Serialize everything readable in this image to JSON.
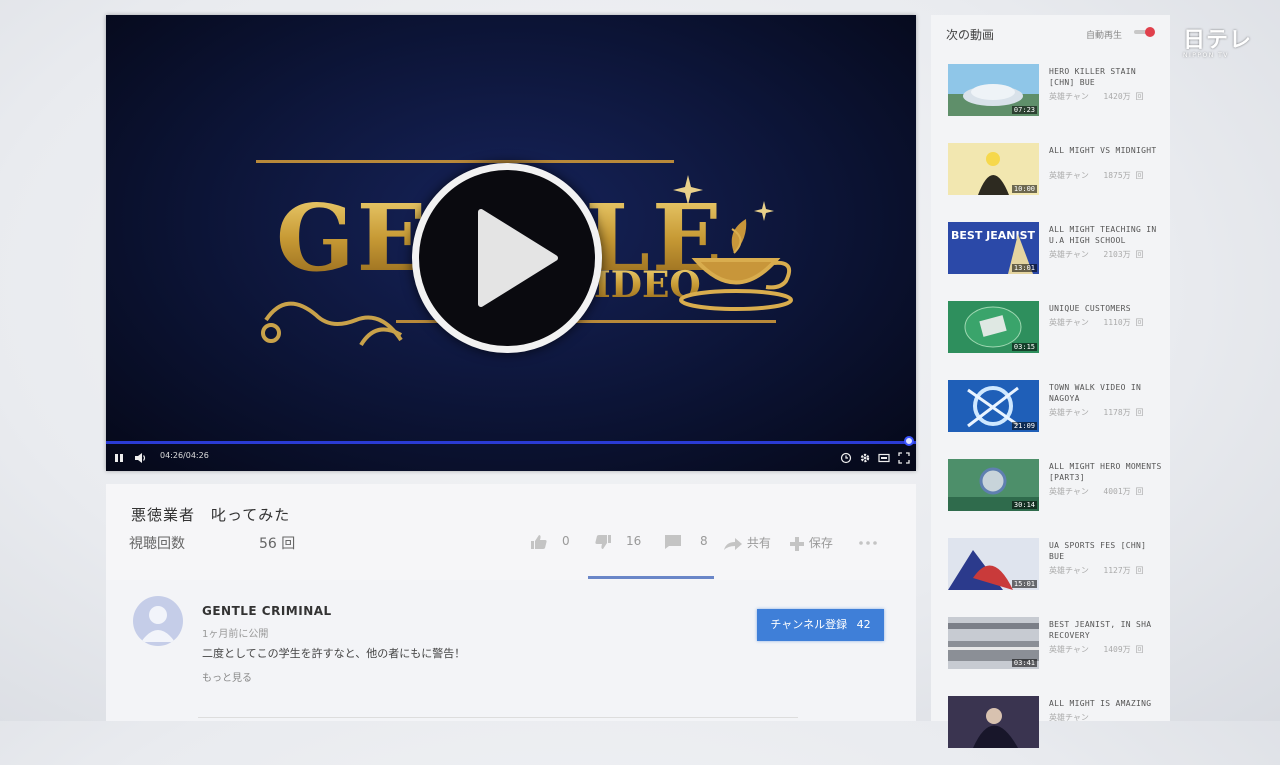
{
  "player": {
    "time": "04:26/04:26",
    "progress": 1.0,
    "logo_word1": "GENTLE",
    "logo_word2": "VIDEO",
    "accent_color": "#2a3bd4"
  },
  "video": {
    "title": "悪徳業者　叱ってみた",
    "views_label": "視聴回数",
    "views_count": "56 回",
    "likes": "0",
    "dislikes": "16",
    "comments": "8",
    "share_label": "共有",
    "save_label": "保存"
  },
  "channel": {
    "name": "GENTLE CRIMINAL",
    "published": "1ヶ月前に公開",
    "description": "二度としてこの学生を許すなと、他の者にもに警告！",
    "more_label": "もっと見る",
    "subscribe_label": "チャンネル登録",
    "subscribers": "42",
    "subscribe_color": "#3f7fd8"
  },
  "sidebar": {
    "title": "次の動画",
    "autoplay_label": "自動再生",
    "items": [
      {
        "title": "HERO KILLER STAIN [CHN] BUE",
        "channel": "英雄チャン",
        "views": "1420万 回",
        "duration": "07:23",
        "thumb": "stadium"
      },
      {
        "title": "ALL MIGHT VS MIDNIGHT",
        "channel": "英雄チャン",
        "views": "1875万 回",
        "duration": "10:00",
        "thumb": "hero"
      },
      {
        "title": "ALL MIGHT TEACHING IN U.A HIGH SCHOOL",
        "channel": "英雄チャン",
        "views": "2103万 回",
        "duration": "13:01",
        "thumb": "jeanist"
      },
      {
        "title": "UNIQUE CUSTOMERS",
        "channel": "英雄チャン",
        "views": "1110万 回",
        "duration": "03:15",
        "thumb": "field"
      },
      {
        "title": "TOWN WALK VIDEO IN NAGOYA",
        "channel": "英雄チャン",
        "views": "1178万 回",
        "duration": "21:09",
        "thumb": "burst"
      },
      {
        "title": "ALL MIGHT HERO MOMENTS [PART3]",
        "channel": "英雄チャン",
        "views": "4001万 回",
        "duration": "30:14",
        "thumb": "arena"
      },
      {
        "title": "UA SPORTS FES [CHN] BUE",
        "channel": "英雄チャン",
        "views": "1127万 回",
        "duration": "15:01",
        "thumb": "caped"
      },
      {
        "title": "BEST JEANIST, IN SHA RECOVERY",
        "channel": "英雄チャン",
        "views": "1409万 回",
        "duration": "03:41",
        "thumb": "track"
      },
      {
        "title": "ALL MIGHT IS AMAZING",
        "channel": "英雄チャン",
        "views": "",
        "duration": "",
        "thumb": "dark"
      }
    ]
  },
  "watermark": {
    "logo": "日テレ",
    "sub": "NIPPON TV"
  }
}
